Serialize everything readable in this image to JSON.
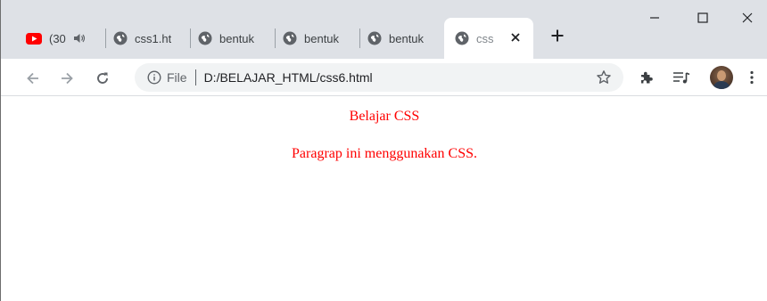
{
  "tabs": [
    {
      "title": "(30",
      "favicon": "youtube-icon",
      "audio": "speaker-icon"
    },
    {
      "title": "css1.ht",
      "favicon": "globe-icon"
    },
    {
      "title": "bentuk",
      "favicon": "globe-icon"
    },
    {
      "title": "bentuk",
      "favicon": "globe-icon"
    },
    {
      "title": "bentuk",
      "favicon": "globe-icon"
    },
    {
      "title": "css",
      "favicon": "globe-icon",
      "active": true
    }
  ],
  "new_tab": "+",
  "window_controls": [
    "minimize",
    "maximize",
    "close"
  ],
  "toolbar": {
    "scheme_label": "File",
    "url": "D:/BELAJAR_HTML/css6.html"
  },
  "page": {
    "heading": "Belajar CSS",
    "paragraph": "Paragrap ini menggunakan CSS.",
    "text_color": "#ff0000"
  },
  "colors": {
    "tabstrip": "#dee1e6",
    "youtube": "#ff0000",
    "omnibox": "#f1f3f4"
  }
}
